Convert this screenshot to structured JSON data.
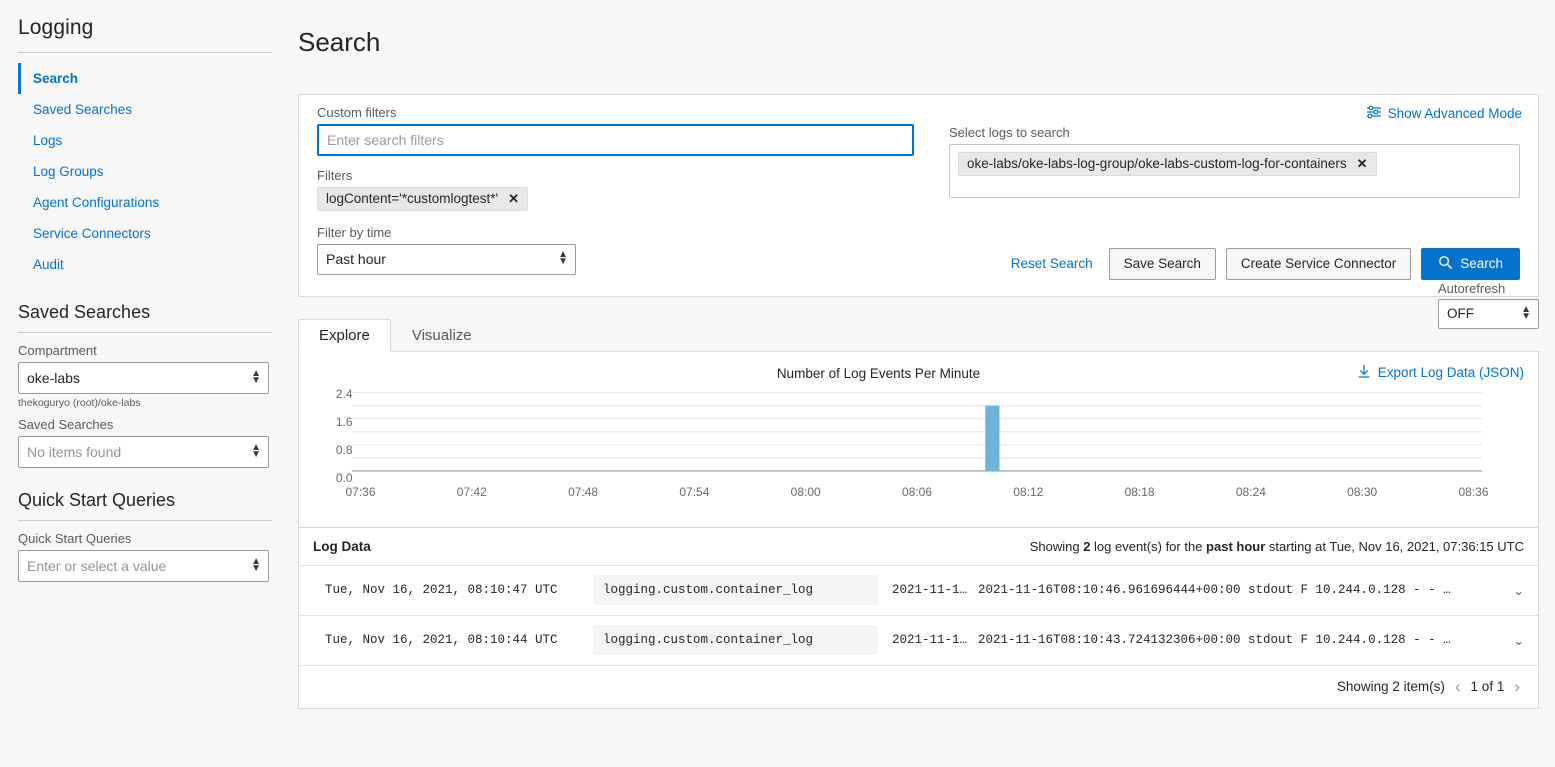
{
  "sidebar": {
    "title": "Logging",
    "nav": [
      {
        "label": "Search",
        "active": true
      },
      {
        "label": "Saved Searches",
        "active": false
      },
      {
        "label": "Logs",
        "active": false
      },
      {
        "label": "Log Groups",
        "active": false
      },
      {
        "label": "Agent Configurations",
        "active": false
      },
      {
        "label": "Service Connectors",
        "active": false
      },
      {
        "label": "Audit",
        "active": false
      }
    ],
    "saved_searches_heading": "Saved Searches",
    "compartment_label": "Compartment",
    "compartment_value": "oke-labs",
    "compartment_helper": "thekoguryo (root)/oke-labs",
    "saved_searches_label": "Saved Searches",
    "saved_searches_placeholder": "No items found",
    "quick_start_heading": "Quick Start Queries",
    "quick_start_label": "Quick Start Queries",
    "quick_start_placeholder": "Enter or select a value"
  },
  "header": {
    "title": "Search"
  },
  "search_panel": {
    "advanced_link": "Show Advanced Mode",
    "custom_filters_label": "Custom filters",
    "custom_filters_placeholder": "Enter search filters",
    "filters_label": "Filters",
    "filter_chip": "logContent='*customlogtest*'",
    "filter_chip_remove": "✕",
    "filter_by_time_label": "Filter by time",
    "filter_by_time_value": "Past hour",
    "select_logs_label": "Select logs to search",
    "selected_log_chip": "oke-labs/oke-labs-log-group/oke-labs-custom-log-for-containers",
    "selected_log_remove": "✕",
    "reset_search": "Reset Search",
    "save_search": "Save Search",
    "create_service_connector": "Create Service Connector",
    "search_button": "Search"
  },
  "results": {
    "autorefresh_label": "Autorefresh",
    "autorefresh_value": "OFF",
    "tabs": [
      {
        "label": "Explore",
        "active": true
      },
      {
        "label": "Visualize",
        "active": false
      }
    ],
    "export_link": "Export Log Data (JSON)",
    "log_data_title": "Log Data",
    "showing_prefix": "Showing ",
    "showing_count": "2",
    "showing_mid": " log event(s) for the ",
    "showing_range": "past hour",
    "showing_suffix": " starting at Tue, Nov 16, 2021, 07:36:15 UTC",
    "rows": [
      {
        "timestamp": "Tue, Nov 16, 2021, 08:10:47 UTC",
        "source": "logging.custom.container_log",
        "date": "2021-11-1…",
        "message": "2021-11-16T08:10:46.961696444+00:00 stdout F 10.244.0.128 - - …",
        "expand_icon": "⌄"
      },
      {
        "timestamp": "Tue, Nov 16, 2021, 08:10:44 UTC",
        "source": "logging.custom.container_log",
        "date": "2021-11-1…",
        "message": "2021-11-16T08:10:43.724132306+00:00 stdout F 10.244.0.128 - - …",
        "expand_icon": "⌄"
      }
    ],
    "pager_showing": "Showing 2 item(s)",
    "pager_prev": "‹",
    "pager_label": "1 of 1",
    "pager_next": "›"
  },
  "chart_data": {
    "type": "bar",
    "title": "Number of Log Events Per Minute",
    "xlabel": "",
    "ylabel": "",
    "ylim": [
      0,
      2.8
    ],
    "yticks": [
      0.0,
      0.8,
      1.6,
      2.4
    ],
    "ytick_labels": [
      "0.0",
      "0.8",
      "1.6",
      "2.4"
    ],
    "xticks": [
      "07:36",
      "07:42",
      "07:48",
      "07:54",
      "08:00",
      "08:06",
      "08:12",
      "08:18",
      "08:24",
      "08:30",
      "08:36"
    ],
    "grid": true,
    "legend": "none",
    "bar_color": "#6eb4d8",
    "categories": [
      "08:10"
    ],
    "values": [
      2
    ]
  },
  "colors": {
    "accent": "#0572ce",
    "bar": "#6eb4d8",
    "page_bg": "#f7f7f7"
  }
}
